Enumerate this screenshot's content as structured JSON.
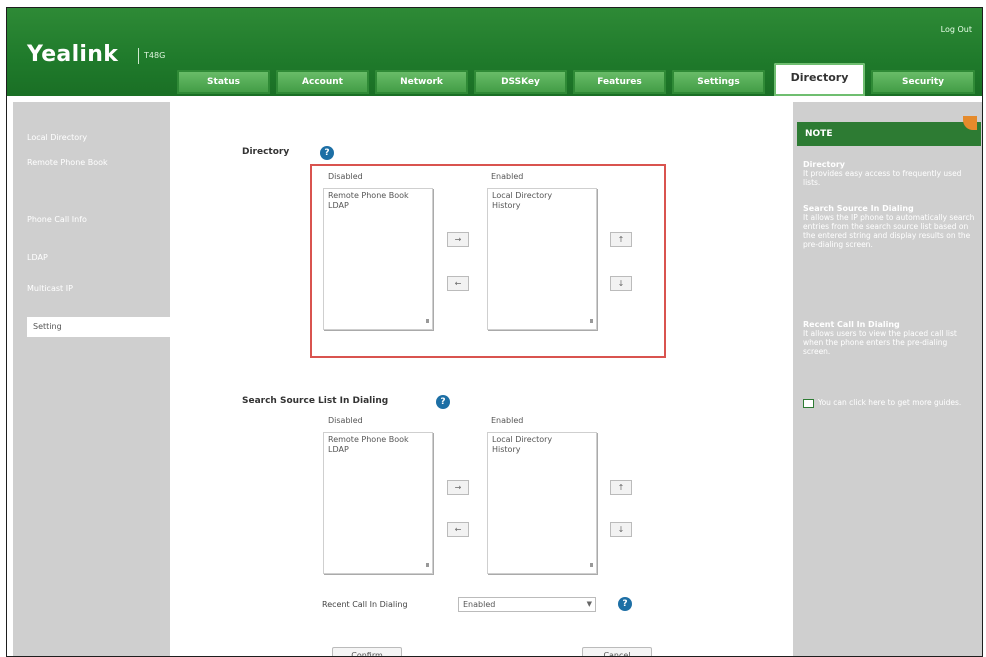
{
  "header": {
    "logo": "Yealink",
    "logo_sub": "T48G",
    "logout": "Log Out",
    "tabs": [
      {
        "label": "Status"
      },
      {
        "label": "Account"
      },
      {
        "label": "Network"
      },
      {
        "label": "DSSKey"
      },
      {
        "label": "Features"
      },
      {
        "label": "Settings"
      },
      {
        "label": "Directory",
        "active": true
      },
      {
        "label": "Security"
      }
    ]
  },
  "sidebar": {
    "items": [
      {
        "label": "Local Directory"
      },
      {
        "label": "Remote Phone Book"
      },
      {
        "label": "Phone Call Info"
      },
      {
        "label": "LDAP"
      },
      {
        "label": "Multicast IP"
      },
      {
        "label": "Setting",
        "active": true
      }
    ]
  },
  "directory": {
    "title": "Directory",
    "disabled_label": "Disabled",
    "enabled_label": "Enabled",
    "disabled_items": [
      "Remote Phone Book",
      "LDAP"
    ],
    "enabled_items": [
      "Local Directory",
      "History"
    ]
  },
  "search_source": {
    "title": "Search Source List In Dialing",
    "disabled_label": "Disabled",
    "enabled_label": "Enabled",
    "disabled_items": [
      "Remote Phone Book",
      "LDAP"
    ],
    "enabled_items": [
      "Local Directory",
      "History"
    ]
  },
  "recent_call": {
    "label": "Recent Call In Dialing",
    "value": "Enabled"
  },
  "buttons": {
    "confirm": "Confirm",
    "cancel": "Cancel"
  },
  "note": {
    "title": "NOTE",
    "blocks": [
      {
        "heading": "Directory",
        "text": "It provides easy access to frequently used lists."
      },
      {
        "heading": "Search Source In Dialing",
        "text": "It allows the IP phone to automatically search entries from the search source list based on the entered string and display results on the pre-dialing screen."
      },
      {
        "heading": "Recent Call In Dialing",
        "text": "It allows users to view the placed call list when the phone enters the pre-dialing screen."
      },
      {
        "heading": "",
        "text": "You can click here to get more guides."
      }
    ]
  },
  "colors": {
    "header_green": "#1f7a2b",
    "highlight_red": "#d9534f",
    "help_blue": "#1d6fa5",
    "note_head_green": "#2d7b33",
    "panel_gray": "#cfcfcf"
  }
}
